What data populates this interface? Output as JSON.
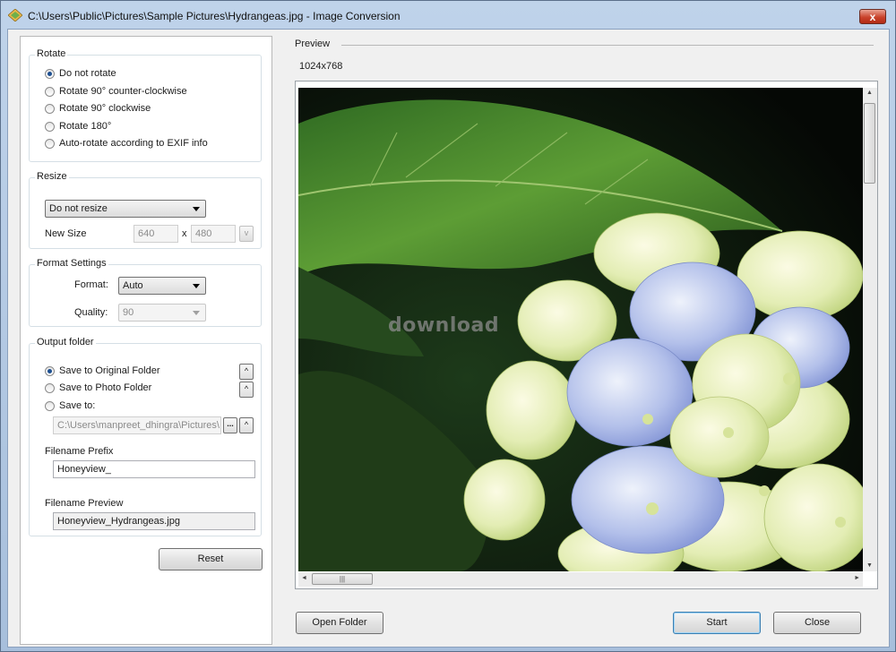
{
  "window": {
    "title": "C:\\Users\\Public\\Pictures\\Sample Pictures\\Hydrangeas.jpg - Image Conversion",
    "close_glyph": "x"
  },
  "rotate": {
    "title": "Rotate",
    "options": [
      "Do not rotate",
      "Rotate 90° counter-clockwise",
      "Rotate 90° clockwise",
      "Rotate 180°",
      "Auto-rotate according to EXIF info"
    ],
    "selected": 0
  },
  "resize": {
    "title": "Resize",
    "mode": "Do not resize",
    "new_size_label": "New Size",
    "width": "640",
    "x_label": "x",
    "height": "480",
    "lock_btn": "v"
  },
  "format": {
    "title": "Format Settings",
    "format_label": "Format:",
    "format_value": "Auto",
    "quality_label": "Quality:",
    "quality_value": "90"
  },
  "output": {
    "title": "Output folder",
    "options": [
      "Save to Original Folder",
      "Save to Photo Folder",
      "Save to:"
    ],
    "selected": 0,
    "path": "C:\\Users\\manpreet_dhingra\\Pictures\\",
    "browse_label": "...",
    "up_glyph": "^",
    "prefix_label": "Filename Prefix",
    "prefix_value": "Honeyview_",
    "preview_label": "Filename Preview",
    "preview_value": "Honeyview_Hydrangeas.jpg"
  },
  "buttons": {
    "reset": "Reset",
    "open_folder": "Open Folder",
    "start": "Start",
    "close": "Close"
  },
  "preview": {
    "title": "Preview",
    "dimensions": "1024x768",
    "watermark": "download"
  },
  "icons": {
    "app": "image-conversion-icon",
    "scroll_up": "▲",
    "scroll_down": "▼",
    "scroll_left": "◄",
    "scroll_right": "►",
    "grip": "|||"
  },
  "colors": {
    "radio_dot": "#1d4f91",
    "close_red": "#c9432c"
  }
}
